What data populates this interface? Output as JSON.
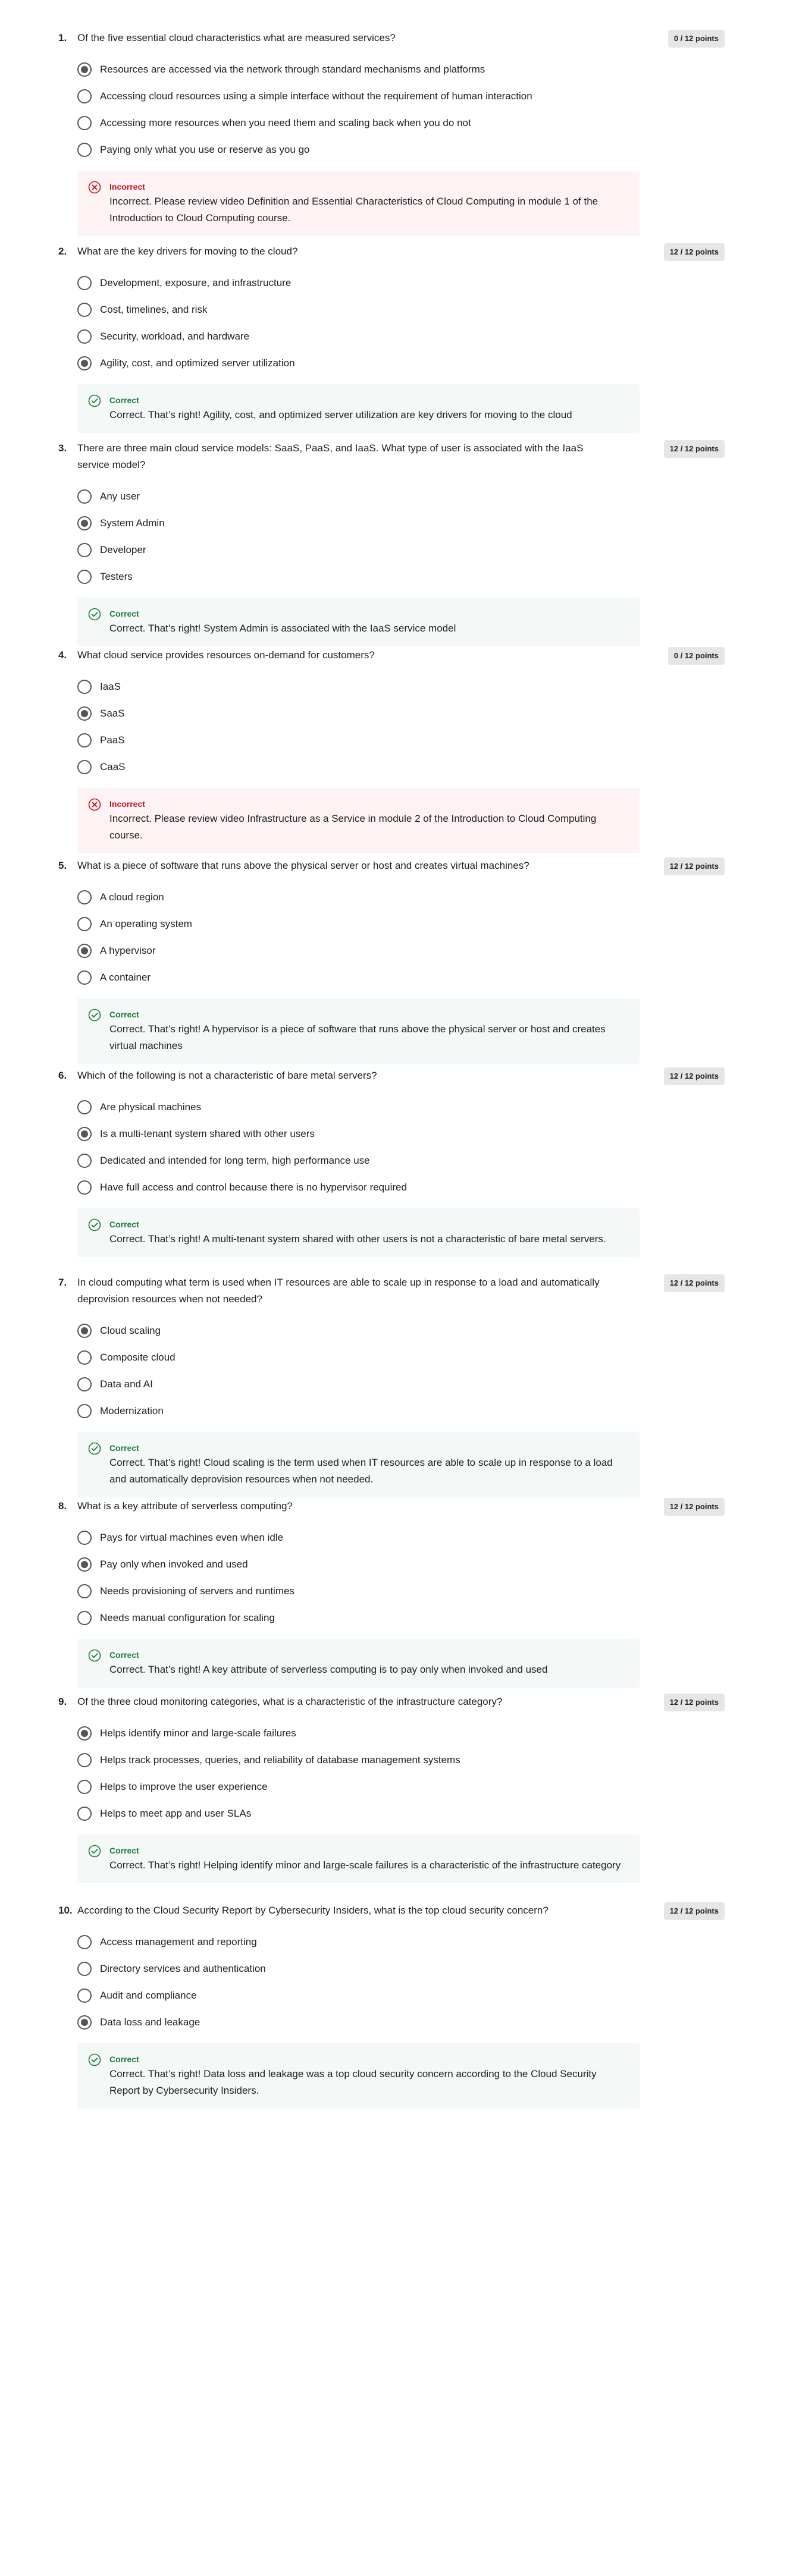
{
  "colors": {
    "correct_green": "#1e7a3c",
    "incorrect_red": "#c4121f",
    "correct_bg": "#f4f8f6",
    "incorrect_bg": "#fdf3f4",
    "points_badge_bg": "#e6e6e6"
  },
  "icons": {
    "correct": "check-circle-icon",
    "incorrect": "x-circle-icon"
  },
  "questions": [
    {
      "number": "1.",
      "text": "Of the five essential cloud characteristics what are measured services?",
      "points": "0 / 12 points",
      "options": [
        {
          "label": "Resources are accessed via the network through standard mechanisms and platforms",
          "selected": true
        },
        {
          "label": "Accessing cloud resources using a simple interface without the requirement of human interaction",
          "selected": false
        },
        {
          "label": "Accessing more resources when you need them and scaling back when you do not",
          "selected": false
        },
        {
          "label": "Paying only what you use or reserve as you go",
          "selected": false
        }
      ],
      "feedback": {
        "status": "incorrect",
        "title": "Incorrect",
        "text": "Incorrect. Please review video Definition and Essential Characteristics of Cloud Computing in module 1 of the Introduction to Cloud Computing course."
      }
    },
    {
      "number": "2.",
      "text": "What are the key drivers for moving to the cloud?",
      "points": "12 / 12 points",
      "options": [
        {
          "label": "Development, exposure, and infrastructure",
          "selected": false
        },
        {
          "label": "Cost, timelines, and risk",
          "selected": false
        },
        {
          "label": "Security, workload, and hardware",
          "selected": false
        },
        {
          "label": "Agility, cost, and optimized server utilization",
          "selected": true
        }
      ],
      "feedback": {
        "status": "correct",
        "title": "Correct",
        "text": "Correct. That’s right! Agility, cost, and optimized server utilization are key drivers for moving to the cloud"
      }
    },
    {
      "number": "3.",
      "text": "There are three main cloud service models: SaaS, PaaS, and IaaS. What type of user is associated with the IaaS service model?",
      "points": "12 / 12 points",
      "options": [
        {
          "label": "Any user",
          "selected": false
        },
        {
          "label": "System Admin",
          "selected": true
        },
        {
          "label": "Developer",
          "selected": false
        },
        {
          "label": "Testers",
          "selected": false
        }
      ],
      "feedback": {
        "status": "correct",
        "title": "Correct",
        "text": "Correct. That’s right! System Admin is associated with the IaaS service model"
      }
    },
    {
      "number": "4.",
      "text": "What cloud service provides resources on-demand for customers?",
      "points": "0 / 12 points",
      "options": [
        {
          "label": "IaaS",
          "selected": false
        },
        {
          "label": "SaaS",
          "selected": true
        },
        {
          "label": "PaaS",
          "selected": false
        },
        {
          "label": "CaaS",
          "selected": false
        }
      ],
      "feedback": {
        "status": "incorrect",
        "title": "Incorrect",
        "text": "Incorrect. Please review video Infrastructure as a Service in module 2 of the Introduction to Cloud Computing course."
      }
    },
    {
      "number": "5.",
      "text": "What is a piece of software that runs above the physical server or host and creates virtual machines?",
      "points": "12 / 12 points",
      "options": [
        {
          "label": "A cloud region",
          "selected": false
        },
        {
          "label": "An operating system",
          "selected": false
        },
        {
          "label": "A hypervisor",
          "selected": true
        },
        {
          "label": "A container",
          "selected": false
        }
      ],
      "feedback": {
        "status": "correct",
        "title": "Correct",
        "text": "Correct. That’s right! A hypervisor is a piece of software that runs above the physical server or host and creates virtual machines"
      }
    },
    {
      "number": "6.",
      "text": "Which of the following is not a characteristic of bare metal servers?",
      "points": "12 / 12 points",
      "options": [
        {
          "label": "Are physical machines",
          "selected": false
        },
        {
          "label": "Is a multi-tenant system shared with other users",
          "selected": true
        },
        {
          "label": "Dedicated and intended for long term, high performance use",
          "selected": false
        },
        {
          "label": "Have full access and control because there is no hypervisor required",
          "selected": false
        }
      ],
      "feedback": {
        "status": "correct",
        "title": "Correct",
        "text": "Correct. That’s right! A multi-tenant system shared with other users is not a characteristic of bare metal servers."
      }
    },
    {
      "number": "7.",
      "text": "In cloud computing what term is used when IT resources are able to scale up in response to a load and automatically deprovision resources when not needed?",
      "points": "12 / 12 points",
      "options": [
        {
          "label": "Cloud scaling",
          "selected": true
        },
        {
          "label": "Composite cloud",
          "selected": false
        },
        {
          "label": "Data and AI",
          "selected": false
        },
        {
          "label": "Modernization",
          "selected": false
        }
      ],
      "feedback": {
        "status": "correct",
        "title": "Correct",
        "text": "Correct. That’s right! Cloud scaling is the term used when IT resources are able to scale up in response to a load and automatically deprovision resources when not needed."
      }
    },
    {
      "number": "8.",
      "text": "What is a key attribute of serverless computing?",
      "points": "12 / 12 points",
      "options": [
        {
          "label": "Pays for virtual machines even when idle",
          "selected": false
        },
        {
          "label": "Pay only when invoked and used",
          "selected": true
        },
        {
          "label": "Needs provisioning of servers and runtimes",
          "selected": false
        },
        {
          "label": "Needs manual configuration for scaling",
          "selected": false
        }
      ],
      "feedback": {
        "status": "correct",
        "title": "Correct",
        "text": "Correct. That’s right! A key attribute of serverless computing is to pay only when invoked and used"
      }
    },
    {
      "number": "9.",
      "text": "Of the three cloud monitoring categories, what is a characteristic of the infrastructure category?",
      "points": "12 / 12 points",
      "options": [
        {
          "label": "Helps identify minor and large-scale failures",
          "selected": true
        },
        {
          "label": "Helps track processes, queries, and reliability of database management systems",
          "selected": false
        },
        {
          "label": "Helps to improve the user experience",
          "selected": false
        },
        {
          "label": "Helps to meet app and user SLAs",
          "selected": false
        }
      ],
      "feedback": {
        "status": "correct",
        "title": "Correct",
        "text": "Correct. That’s right! Helping identify minor and large-scale failures is a characteristic of the infrastructure category"
      }
    },
    {
      "number": "10.",
      "text": "According to the Cloud Security Report by Cybersecurity Insiders, what is the top cloud security concern?",
      "points": "12 / 12 points",
      "options": [
        {
          "label": "Access management and reporting",
          "selected": false
        },
        {
          "label": "Directory services and authentication",
          "selected": false
        },
        {
          "label": "Audit and compliance",
          "selected": false
        },
        {
          "label": "Data loss and leakage",
          "selected": true
        }
      ],
      "feedback": {
        "status": "correct",
        "title": "Correct",
        "text": "Correct. That’s right! Data loss and leakage was a top cloud security concern according to the Cloud Security Report by Cybersecurity Insiders."
      }
    }
  ]
}
